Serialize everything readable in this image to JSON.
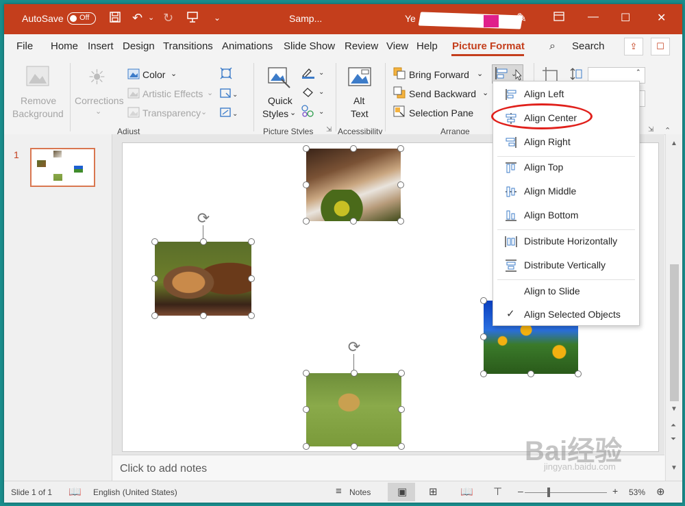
{
  "titlebar": {
    "autosave_label": "AutoSave",
    "autosave_state": "Off",
    "doc_title": "Samp...",
    "user_initial": "Ye"
  },
  "tabs": {
    "items": [
      "File",
      "Home",
      "Insert",
      "Design",
      "Transitions",
      "Animations",
      "Slide Show",
      "Review",
      "View",
      "Help",
      "Picture Format"
    ],
    "search_label": "Search"
  },
  "ribbon": {
    "remove_background": [
      "Remove",
      "Background"
    ],
    "corrections": "Corrections",
    "color": "Color",
    "artistic_effects": "Artistic Effects",
    "transparency": "Transparency",
    "adjust_group": "Adjust",
    "quick_styles": [
      "Quick",
      "Styles"
    ],
    "picture_styles_group": "Picture Styles",
    "alt_text": [
      "Alt",
      "Text"
    ],
    "accessibility_group": "Accessibility",
    "bring_forward": "Bring Forward",
    "send_backward": "Send Backward",
    "selection_pane": "Selection Pane",
    "arrange_group": "Arrange"
  },
  "slides_pane": {
    "slide_number": "1"
  },
  "align_menu": {
    "items": [
      {
        "label": "Align Left",
        "icon": "align-left-icon"
      },
      {
        "label": "Align Center",
        "icon": "align-center-icon"
      },
      {
        "label": "Align Right",
        "icon": "align-right-icon"
      },
      {
        "label": "Align Top",
        "icon": "align-top-icon"
      },
      {
        "label": "Align Middle",
        "icon": "align-middle-icon"
      },
      {
        "label": "Align Bottom",
        "icon": "align-bottom-icon"
      },
      {
        "label": "Distribute Horizontally",
        "icon": "distribute-horizontally-icon"
      },
      {
        "label": "Distribute Vertically",
        "icon": "distribute-vertically-icon"
      },
      {
        "label": "Align to Slide",
        "icon": ""
      },
      {
        "label": "Align Selected Objects",
        "icon": "checkmark-icon",
        "checked": true
      }
    ]
  },
  "notes": {
    "placeholder": "Click to add notes"
  },
  "statusbar": {
    "slide_info": "Slide 1 of 1",
    "language": "English (United States)",
    "notes_label": "Notes",
    "zoom_minus": "–",
    "zoom_plus": "+",
    "zoom": "53%"
  },
  "watermark": {
    "brand": "Bai经验",
    "url": "jingyan.baidu.com"
  },
  "colors": {
    "accent": "#c43e1c",
    "highlight": "#e0201b"
  }
}
